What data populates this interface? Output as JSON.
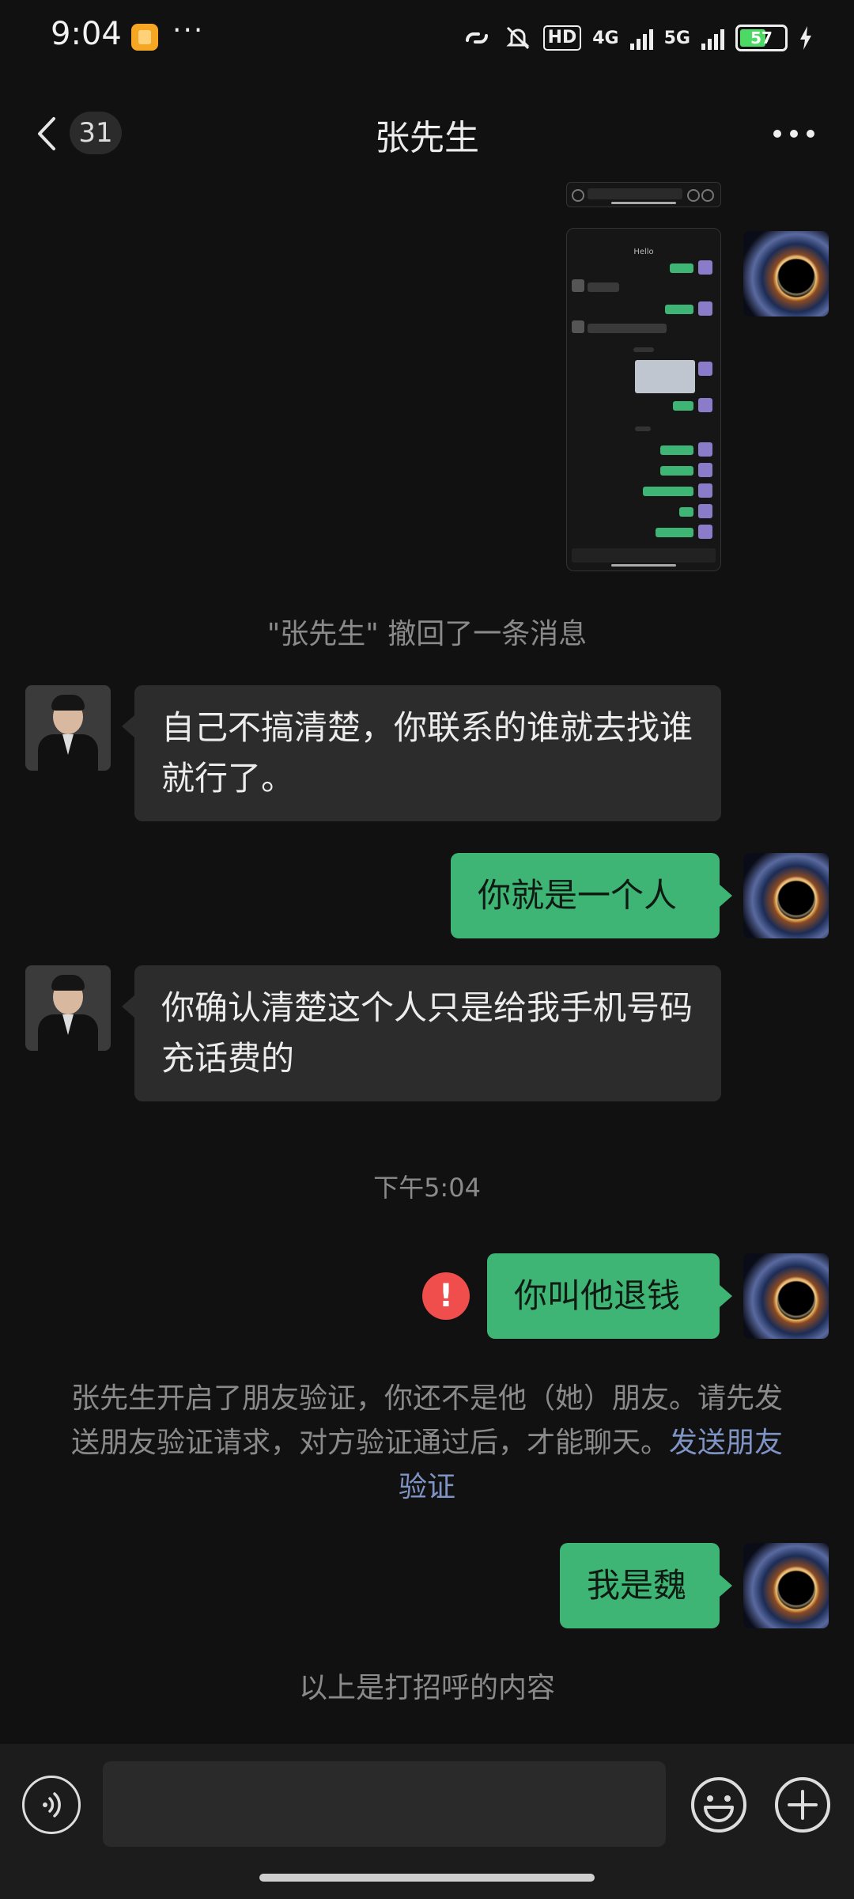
{
  "status_bar": {
    "time": "9:04",
    "overflow": "···",
    "hd_label": "HD",
    "net1": "4G",
    "net2": "5G",
    "battery": "57"
  },
  "header": {
    "unread_count": "31",
    "title": "张先生"
  },
  "messages": {
    "recalled": "\"张先生\" 撤回了一条消息",
    "other_1": "自己不搞清楚，你联系的谁就去找谁就行了。",
    "me_1": "你就是一个人",
    "other_2": "你确认清楚这个人只是给我手机号码充话费的",
    "time_divider": "下午5:04",
    "me_2_failed": "你叫他退钱",
    "failed_icon": "!",
    "verify_notice": "张先生开启了朋友验证，你还不是他（她）朋友。请先发送朋友验证请求，对方验证通过后，才能聊天。",
    "verify_link": "发送朋友验证",
    "me_3": "我是魏",
    "greeting_note": "以上是打招呼的内容"
  },
  "screenshot_msg": {
    "title": "Hello"
  },
  "colors": {
    "background": "#111111",
    "bubble_me": "#3eb575",
    "bubble_other": "#2c2c2c",
    "link": "#7f93c4",
    "error": "#f04d4d"
  }
}
